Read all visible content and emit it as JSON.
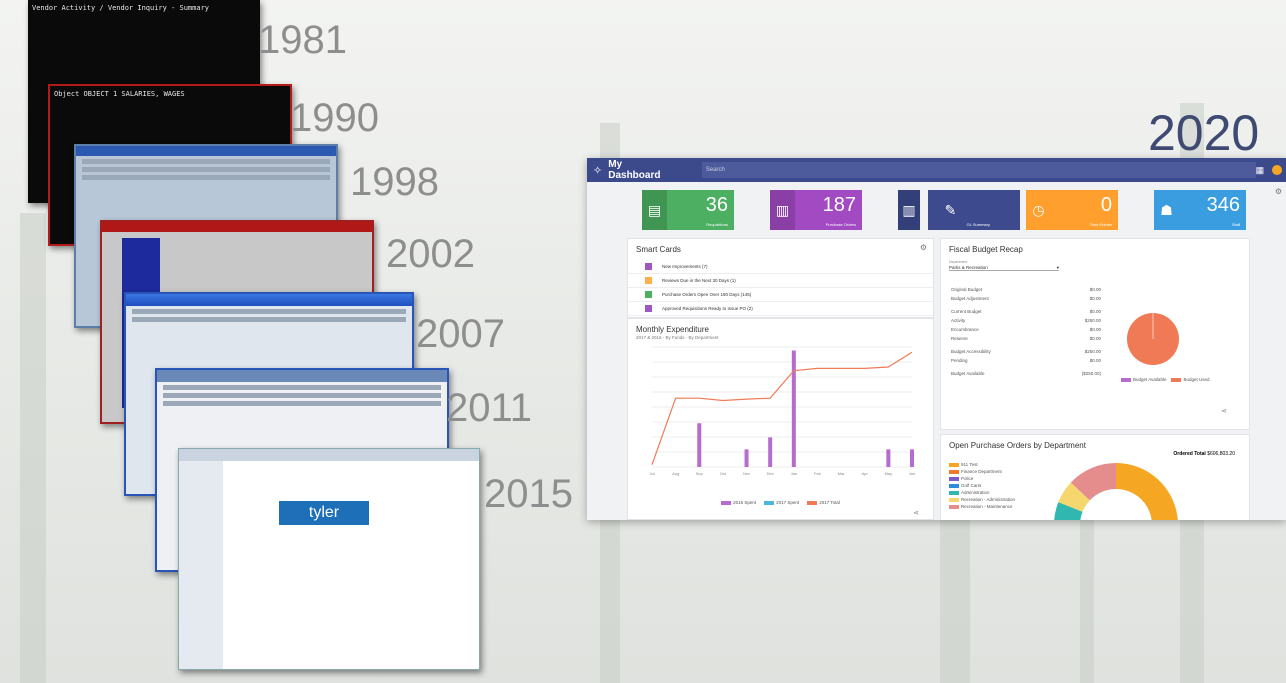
{
  "years": [
    "1981",
    "1990",
    "1998",
    "2002",
    "2007",
    "2011",
    "2015",
    "2020"
  ],
  "legacy": {
    "term1981_line1": "Vendor Activity / Vendor Inquiry - Summary",
    "term1990_line1": "Object  OBJECT   1 SALARIES, WAGES",
    "app2015_logo": "tyler"
  },
  "dashboard": {
    "title": "My Dashboard",
    "search_placeholder": "Search",
    "tiles": [
      {
        "value": "36",
        "label": "Requisitions",
        "color": "#4caf62",
        "icon": "clipboard-icon"
      },
      {
        "value": "187",
        "label": "Purchase Orders",
        "color": "#a24ac2",
        "icon": "document-icon"
      },
      {
        "value": "",
        "label": "GL Summary",
        "color": "#3d4a8e",
        "icon": "bar-chart-icon"
      },
      {
        "value": "",
        "label": "GL Summary",
        "color": "#3d4a8e",
        "icon": "edit-icon"
      },
      {
        "value": "0",
        "label": "Time Entries",
        "color": "#ff9f2e",
        "icon": "clock-icon"
      },
      {
        "value": "346",
        "label": "Staff",
        "color": "#3a9de0",
        "icon": "people-icon"
      }
    ],
    "smart_cards": {
      "title": "Smart Cards",
      "items": [
        {
          "text": "New Improvements (7)",
          "color": "#9e57c4"
        },
        {
          "text": "Reviews Due in the Next 30 Days (1)",
          "color": "#ffb04a"
        },
        {
          "text": "Purchase Orders Open Over 180 Days (145)",
          "color": "#4caf62"
        },
        {
          "text": "Approved Requisitions Ready to Issue PO (2)",
          "color": "#9e57c4"
        }
      ]
    },
    "monthly": {
      "title": "Monthly Expenditure",
      "subtitle": "2017 & 2016 - By Funds - By Department",
      "legend": [
        "2016 Spent",
        "2017 Spent",
        "2017 Total"
      ]
    },
    "fiscal": {
      "title": "Fiscal Budget Recap",
      "dept_label": "Department",
      "dept_value": "Parks & Recreation",
      "rows": [
        {
          "label": "Original Budget",
          "value": "$0.00"
        },
        {
          "label": "Budget Adjustment",
          "value": "$0.00"
        },
        {
          "label": "Current Budget",
          "value": "$0.00"
        },
        {
          "label": "Activity",
          "value": "$250.00"
        },
        {
          "label": "Encumbrance",
          "value": "$0.00"
        },
        {
          "label": "Reserve",
          "value": "$0.00"
        },
        {
          "label": "Budget Accessibility",
          "value": "$250.00"
        },
        {
          "label": "Pending",
          "value": "$0.00"
        },
        {
          "label": "Budget Available",
          "value": "($250.00)"
        }
      ],
      "pie_legend": [
        "Budget Available",
        "Budget Used"
      ]
    },
    "open_po": {
      "title": "Open Purchase Orders by Department",
      "total_label": "Ordered Total",
      "total_value": "$606,803.20",
      "legend": [
        {
          "name": "911 Test",
          "color": "#f5a623"
        },
        {
          "name": "Finance Department",
          "color": "#f07a2a"
        },
        {
          "name": "Police",
          "color": "#7b5cc8"
        },
        {
          "name": "Golf Carts",
          "color": "#2e8bd8"
        },
        {
          "name": "Administration",
          "color": "#30b8b0"
        },
        {
          "name": "Recreation - Administration",
          "color": "#f5d76e"
        },
        {
          "name": "Recreation - Maintenance",
          "color": "#e58d8d"
        }
      ]
    }
  },
  "chart_data": {
    "type": "bar",
    "title": "Monthly Expenditure",
    "categories": [
      "Jul",
      "Aug",
      "Sep",
      "Oct",
      "Nov",
      "Dec",
      "Jan",
      "Feb",
      "Mar",
      "Apr",
      "May",
      "Jun"
    ],
    "series": [
      {
        "name": "2016 Spent",
        "values": [
          0,
          0,
          62,
          0,
          25,
          42,
          165,
          0,
          0,
          0,
          25,
          25
        ]
      },
      {
        "name": "2017 Spent",
        "values": [
          0,
          0,
          0,
          0,
          0,
          0,
          0,
          0,
          0,
          0,
          0,
          0
        ]
      },
      {
        "name": "2017 Total",
        "type": "line",
        "values": [
          5,
          150,
          150,
          145,
          148,
          150,
          210,
          215,
          215,
          215,
          218,
          250
        ]
      }
    ],
    "ylim": [
      0,
      170
    ]
  }
}
